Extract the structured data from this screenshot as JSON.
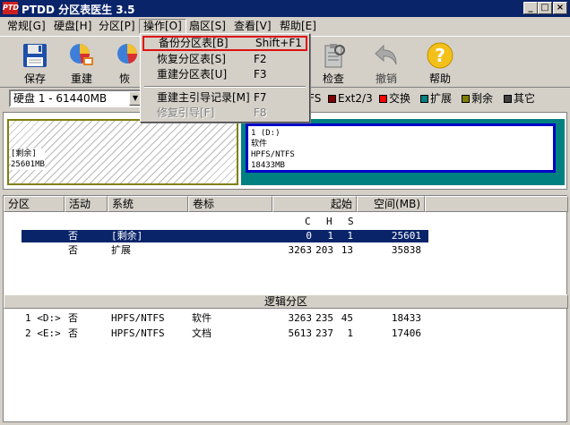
{
  "window": {
    "app_icon_text": "PTD",
    "title": "PTDD 分区表医生 3.5",
    "min_glyph": "_",
    "max_glyph": "□",
    "close_glyph": "×"
  },
  "menu": [
    "常规[G]",
    "硬盘[H]",
    "分区[P]",
    "操作[O]",
    "扇区[S]",
    "查看[V]",
    "帮助[E]"
  ],
  "toolbar": {
    "save": "保存",
    "rebuild": "重建",
    "restore": "恢",
    "check": "检查",
    "undo": "撤销",
    "help": "帮助"
  },
  "dropdown": {
    "items": [
      {
        "label": "备份分区表[B]",
        "shortcut": "Shift+F1"
      },
      {
        "label": "恢复分区表[S]",
        "shortcut": "F2"
      },
      {
        "label": "重建分区表[U]",
        "shortcut": "F3"
      },
      {
        "label": "重建主引导记录[M]",
        "shortcut": "F7"
      },
      {
        "label": "修复引导[F]",
        "shortcut": "F8"
      }
    ]
  },
  "disk": {
    "selected": "硬盘 1 - 61440MB",
    "dropdown_glyph": "▼"
  },
  "legend": [
    {
      "label": "FS",
      "color": "#d4d0c8"
    },
    {
      "label": "Ext2/3",
      "color": "#800000"
    },
    {
      "label": "交换",
      "color": "#ff0000"
    },
    {
      "label": "扩展",
      "color": "#008080"
    },
    {
      "label": "剩余",
      "color": "#808000"
    },
    {
      "label": "其它",
      "color": "#404040"
    }
  ],
  "diskmap": {
    "free": {
      "line1": "[剩余]",
      "line2": "25601MB"
    },
    "ntfs": {
      "line1": "1 (D:)",
      "line2": "软件",
      "line3": "HPFS/NTFS",
      "line4": "18433MB"
    }
  },
  "list": {
    "headers": {
      "partition": "分区",
      "active": "活动",
      "system": "系统",
      "label": "卷标",
      "start": "起始",
      "size": "空间(MB)"
    },
    "chs": {
      "c": "C",
      "h": "H",
      "s": "S"
    },
    "primary_rows": [
      {
        "part": "",
        "active": "否",
        "system": "[剩余]",
        "label": "",
        "c": "0",
        "h": "1",
        "s": "1",
        "size": "25601"
      },
      {
        "part": "",
        "active": "否",
        "system": "扩展",
        "label": "",
        "c": "3263",
        "h": "203",
        "s": "13",
        "size": "35838"
      }
    ],
    "logical_title": "逻辑分区",
    "logical_rows": [
      {
        "part": "1 <D:>",
        "active": "否",
        "system": "HPFS/NTFS",
        "label": "软件",
        "c": "3263",
        "h": "235",
        "s": "45",
        "size": "18433"
      },
      {
        "part": "2 <E:>",
        "active": "否",
        "system": "HPFS/NTFS",
        "label": "文档",
        "c": "5613",
        "h": "237",
        "s": "1",
        "size": "17406"
      }
    ]
  }
}
